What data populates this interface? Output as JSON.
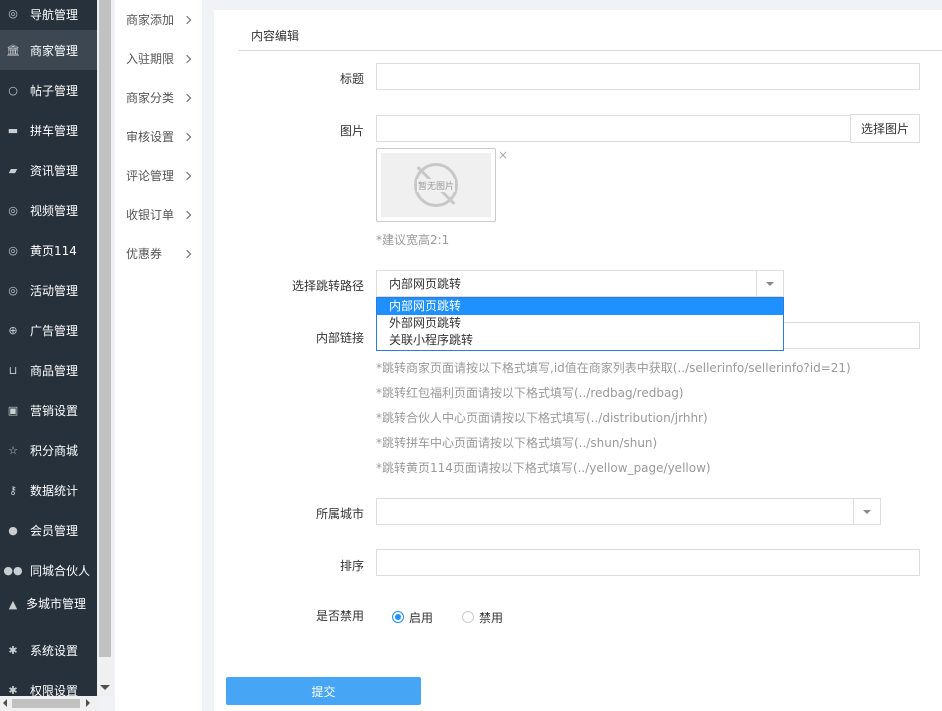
{
  "sidebar": {
    "items": [
      {
        "label": "导航管理",
        "icon": "compass-icon"
      },
      {
        "label": "商家管理",
        "icon": "bank-icon"
      },
      {
        "label": "帖子管理",
        "icon": "comment-icon"
      },
      {
        "label": "拼车管理",
        "icon": "car-icon"
      },
      {
        "label": "资讯管理",
        "icon": "book-icon"
      },
      {
        "label": "视频管理",
        "icon": "compass-icon"
      },
      {
        "label": "黄页114",
        "icon": "compass-icon"
      },
      {
        "label": "活动管理",
        "icon": "compass-icon"
      },
      {
        "label": "广告管理",
        "icon": "lifebuoy-icon"
      },
      {
        "label": "商品管理",
        "icon": "cart-icon"
      },
      {
        "label": "营销设置",
        "icon": "gift-icon"
      },
      {
        "label": "积分商城",
        "icon": "star-icon"
      },
      {
        "label": "数据统计",
        "icon": "key-icon"
      },
      {
        "label": "会员管理",
        "icon": "user-icon"
      },
      {
        "label": "同城合伙人",
        "icon": "users-icon"
      },
      {
        "label": "多城市管理",
        "icon": "graduation-cap-icon"
      },
      {
        "label": "系统设置",
        "icon": "gear-icon"
      },
      {
        "label": "权限设置",
        "icon": "gear-icon"
      }
    ]
  },
  "submenu": {
    "items": [
      {
        "label": "商家添加"
      },
      {
        "label": "入驻期限"
      },
      {
        "label": "商家分类"
      },
      {
        "label": "审核设置"
      },
      {
        "label": "评论管理"
      },
      {
        "label": "收银订单"
      },
      {
        "label": "优惠券"
      }
    ]
  },
  "form": {
    "section_title": "内容编辑",
    "title_label": "标题",
    "title_value": "",
    "image_label": "图片",
    "image_value": "",
    "pick_image": "选择图片",
    "no_image": "暂无图片",
    "image_remove": "×",
    "image_hint": "*建议宽高2:1",
    "jump_label": "选择跳转路径",
    "jump_selected": "内部网页跳转",
    "jump_options": [
      "内部网页跳转",
      "外部网页跳转",
      "关联小程序跳转"
    ],
    "link_label": "内部链接",
    "link_value": "",
    "hints": [
      "*跳转商家页面请按以下格式填写,id值在商家列表中获取(../sellerinfo/sellerinfo?id=21)",
      "*跳转红包福利页面请按以下格式填写(../redbag/redbag)",
      "*跳转合伙人中心页面请按以下格式填写(../distribution/jrhhr)",
      "*跳转拼车中心页面请按以下格式填写(../shun/shun)",
      "*跳转黄页114页面请按以下格式填写(../yellow_page/yellow)"
    ],
    "city_label": "所属城市",
    "city_value": "",
    "sort_label": "排序",
    "sort_value": "",
    "status_label": "是否禁用",
    "status_options": [
      "启用",
      "禁用"
    ],
    "status_selected": "启用",
    "submit": "提交"
  },
  "colors": {
    "sidebar_bg": "#27313b",
    "sidebar_active": "#3c4751",
    "accent": "#1e90ff",
    "submit_bg": "#46a6f5"
  }
}
